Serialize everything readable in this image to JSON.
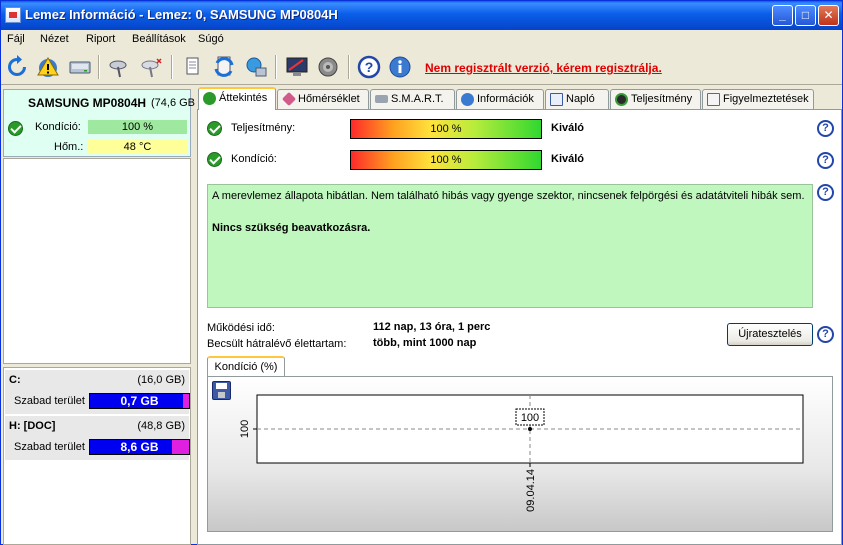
{
  "window": {
    "title": "Lemez Információ - Lemez: 0, SAMSUNG MP0804H"
  },
  "menu": [
    "Fájl",
    "Nézet",
    "Riport",
    "Beállítások",
    "Súgó"
  ],
  "toolbar": {
    "icons": [
      "refresh-icon",
      "warning-icon",
      "disk-icon",
      "satellite-icon",
      "satellite-off-icon",
      "copy-icon",
      "sync-icon",
      "network-icon",
      "monitor-icon",
      "speaker-icon",
      "help-icon",
      "info-icon"
    ],
    "warning_link": "Nem regisztrált verzió, kérem regisztrálja."
  },
  "disk": {
    "name": "SAMSUNG MP0804H",
    "size": "(74,6 GB",
    "condition_label": "Kondíció:",
    "condition_value": "100 %",
    "temp_label": "Hőm.:",
    "temp_value": "48 °C"
  },
  "volumes": [
    {
      "name": "C:",
      "size": "(16,0 GB)",
      "free_label": "Szabad terület",
      "free_value": "0,7 GB"
    },
    {
      "name": "H: [DOC]",
      "size": "(48,8 GB)",
      "free_label": "Szabad terület",
      "free_value": "8,6 GB"
    }
  ],
  "tabs": [
    "Áttekintés",
    "Hőmérséklet",
    "S.M.A.R.T.",
    "Információk",
    "Napló",
    "Teljesítmény",
    "Figyelmeztetések"
  ],
  "overview": {
    "performance_label": "Teljesítmény:",
    "performance_value": "100 %",
    "performance_verdict": "Kiváló",
    "condition_label": "Kondíció:",
    "condition_value": "100 %",
    "condition_verdict": "Kiváló",
    "status_text": "A merevlemez állapota hibátlan. Nem található hibás vagy gyenge szektor, nincsenek felpörgési és adatátviteli hibák sem.",
    "status_strong": "Nincs szükség beavatkozásra.",
    "uptime_label": "Működési idő:",
    "uptime_value": "112 nap, 13 óra, 1 perc",
    "life_label": "Becsült hátralévő élettartam:",
    "life_value": "több, mint 1000 nap",
    "retest_button": "Újratesztelés",
    "chart_tab": "Kondíció  (%)"
  },
  "chart_data": {
    "type": "line",
    "x": [
      "09.04.14"
    ],
    "series": [
      {
        "values": [
          100
        ]
      }
    ],
    "data_labels": [
      "100"
    ],
    "y_tick_labels": [
      "100"
    ],
    "grid": true
  }
}
